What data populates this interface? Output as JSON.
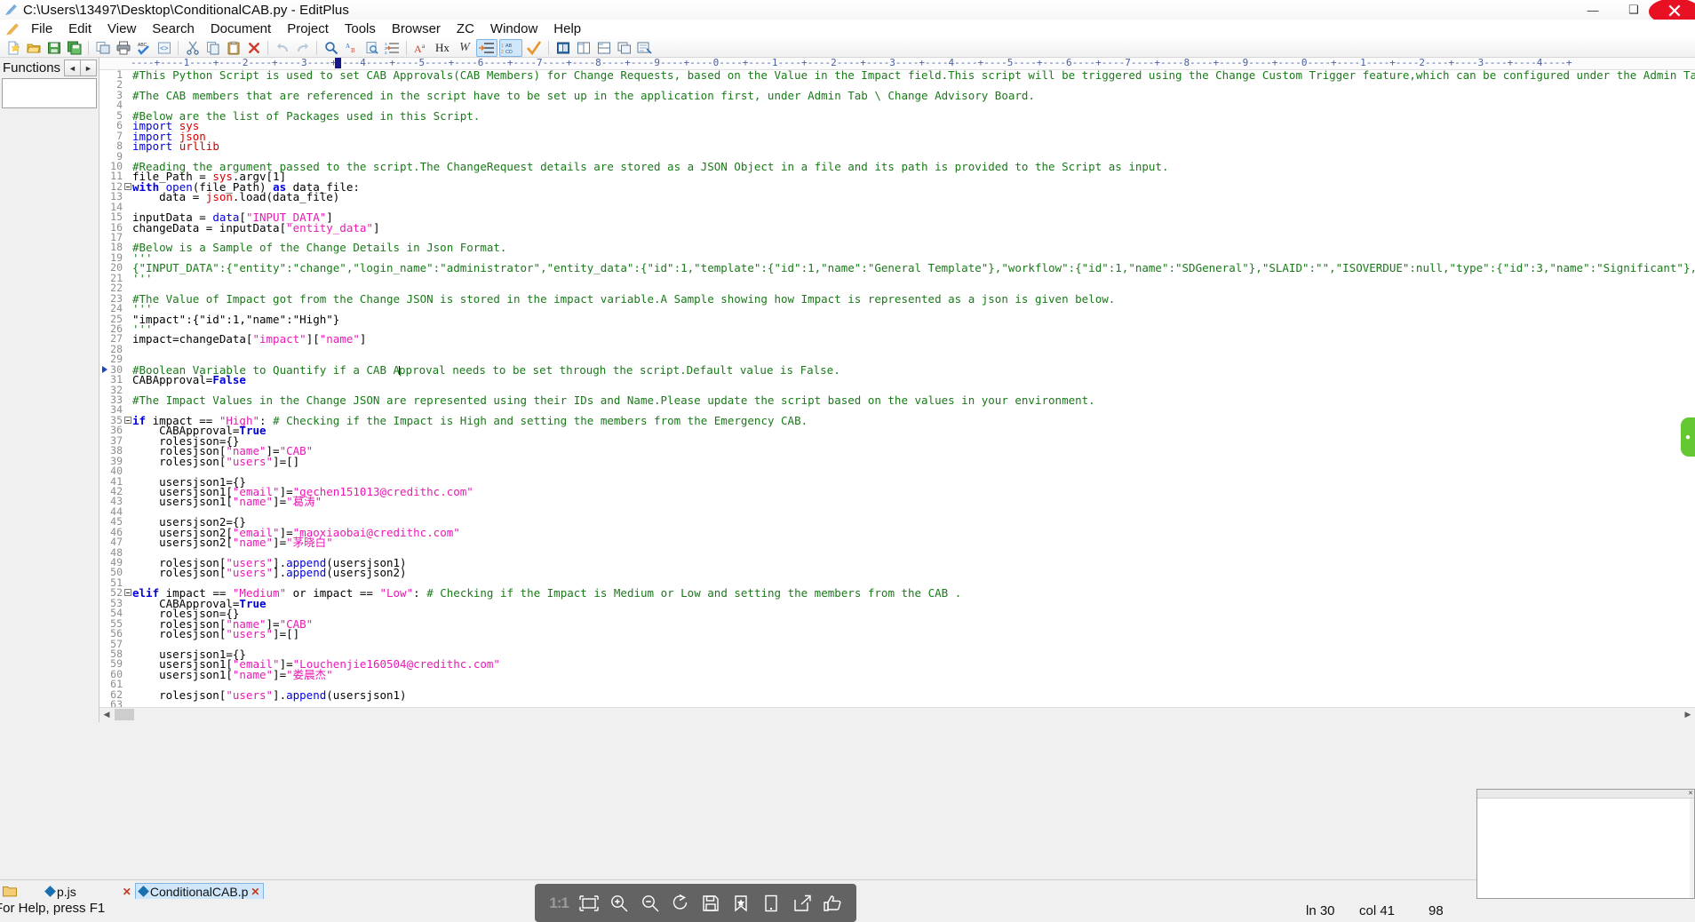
{
  "window": {
    "title": "C:\\Users\\13497\\Desktop\\ConditionalCAB.py - EditPlus",
    "minimize": "—",
    "maximize": "❑",
    "close": "✕"
  },
  "menu": {
    "items": [
      "File",
      "Edit",
      "View",
      "Search",
      "Document",
      "Project",
      "Tools",
      "Browser",
      "ZC",
      "Window",
      "Help"
    ]
  },
  "toolbar": {
    "groups": [
      [
        "new-file",
        "open-file",
        "save-file",
        "save-all"
      ],
      [
        "print-preview",
        "print",
        "spell-check",
        "view-source"
      ],
      [
        "cut",
        "copy",
        "paste",
        "delete"
      ],
      [
        "undo",
        "redo"
      ],
      [
        "find",
        "find-replace",
        "find-in-files",
        "goto-line"
      ],
      [
        "font-color",
        "hex-view",
        "word-wrap",
        "indent",
        "sort",
        "check-syntax"
      ],
      [
        "browser-preview",
        "user-tool"
      ]
    ],
    "labels": {
      "hex": "Hx",
      "word": "W",
      "abcd_top": "1 AB",
      "abcd_bottom": "2 CD"
    }
  },
  "functions_pane": {
    "title": "Functions",
    "prev_label": "◄",
    "next_label": "►"
  },
  "ruler": {
    "text": "----+----1----+----2----+----3----+----4----+----5----+----6----+----7----+----8----+----9----+----0----+----1----+----2----+----3----+----4----+----5----+----6----+----7----+----8----+----9----+----0----+----1----+----2----+----3----+----4----+",
    "caret_column_marker": "4"
  },
  "editor": {
    "lines": [
      {
        "n": 1,
        "mark": "",
        "tokens": [
          {
            "t": "#This Python Script is used to set CAB Approvals(CAB Members) for Change Requests, based on the Value in the Impact field.This script will be triggered using the Change Custom Trigger feature,which can be configured under the Admin Tab \\ Change",
            "c": "com"
          }
        ]
      },
      {
        "n": 2,
        "mark": "",
        "tokens": []
      },
      {
        "n": 3,
        "mark": "",
        "tokens": [
          {
            "t": "#The CAB members that are referenced in the script have to be set up in the application first, under Admin Tab \\ Change Advisory Board.",
            "c": "com"
          }
        ]
      },
      {
        "n": 4,
        "mark": "",
        "tokens": []
      },
      {
        "n": 5,
        "mark": "",
        "tokens": [
          {
            "t": "#Below are the list of Packages used in this Script.",
            "c": "com"
          }
        ]
      },
      {
        "n": 6,
        "mark": "",
        "tokens": [
          {
            "t": "import ",
            "c": "kw2"
          },
          {
            "t": "sys",
            "c": "mod"
          }
        ]
      },
      {
        "n": 7,
        "mark": "",
        "tokens": [
          {
            "t": "import ",
            "c": "kw2"
          },
          {
            "t": "json",
            "c": "mod"
          }
        ]
      },
      {
        "n": 8,
        "mark": "",
        "tokens": [
          {
            "t": "import ",
            "c": "kw2"
          },
          {
            "t": "urllib",
            "c": "mod"
          }
        ]
      },
      {
        "n": 9,
        "mark": "",
        "tokens": []
      },
      {
        "n": 10,
        "mark": "",
        "tokens": [
          {
            "t": "#Reading the argument passed to the script.The ChangeRequest details are stored as a JSON Object in a file and its path is provided to the Script as input.",
            "c": "com"
          }
        ]
      },
      {
        "n": 11,
        "mark": "",
        "tokens": [
          {
            "t": "file_Path = ",
            "c": ""
          },
          {
            "t": "sys",
            "c": "mod"
          },
          {
            "t": ".argv[",
            "c": ""
          },
          {
            "t": "1",
            "c": ""
          },
          {
            "t": "]",
            "c": ""
          }
        ]
      },
      {
        "n": 12,
        "mark": "fold",
        "tokens": [
          {
            "t": "with ",
            "c": "kw"
          },
          {
            "t": "open",
            "c": "kw2"
          },
          {
            "t": "(file_Path) ",
            "c": ""
          },
          {
            "t": "as",
            "c": "kw"
          },
          {
            "t": " data_file:",
            "c": ""
          }
        ]
      },
      {
        "n": 13,
        "mark": "",
        "tokens": [
          {
            "t": "    data = ",
            "c": ""
          },
          {
            "t": "json",
            "c": "mod"
          },
          {
            "t": ".load(data_file)",
            "c": ""
          }
        ]
      },
      {
        "n": 14,
        "mark": "",
        "tokens": []
      },
      {
        "n": 15,
        "mark": "",
        "tokens": [
          {
            "t": "inputData = ",
            "c": ""
          },
          {
            "t": "data",
            "c": "kw2"
          },
          {
            "t": "[",
            "c": ""
          },
          {
            "t": "\"INPUT_DATA\"",
            "c": "str"
          },
          {
            "t": "]",
            "c": ""
          }
        ]
      },
      {
        "n": 16,
        "mark": "",
        "tokens": [
          {
            "t": "changeData = inputData[",
            "c": ""
          },
          {
            "t": "\"entity_data\"",
            "c": "str"
          },
          {
            "t": "]",
            "c": ""
          }
        ]
      },
      {
        "n": 17,
        "mark": "",
        "tokens": []
      },
      {
        "n": 18,
        "mark": "",
        "tokens": [
          {
            "t": "#Below is a Sample of the Change Details in Json Format.",
            "c": "com"
          }
        ]
      },
      {
        "n": 19,
        "mark": "",
        "tokens": [
          {
            "t": "'''",
            "c": "com"
          }
        ]
      },
      {
        "n": 20,
        "mark": "",
        "tokens": [
          {
            "t": "{\"INPUT_DATA\":{\"entity\":\"change\",\"login_name\":\"administrator\",\"entity_data\":{\"id\":1,\"template\":{\"id\":1,\"name\":\"General Template\"},\"workflow\":{\"id\":1,\"name\":\"SDGeneral\"},\"SLAID\":\"\",\"ISOVERDUE\":null,\"type\":{\"id\":3,\"name\":\"Significant\"},\"group\":nul",
            "c": "com"
          }
        ]
      },
      {
        "n": 21,
        "mark": "",
        "tokens": [
          {
            "t": "'''",
            "c": "com"
          }
        ]
      },
      {
        "n": 22,
        "mark": "",
        "tokens": []
      },
      {
        "n": 23,
        "mark": "",
        "tokens": [
          {
            "t": "#The Value of Impact got from the Change JSON is stored in the impact variable.A Sample showing how Impact is represented as a json is given below.",
            "c": "com"
          }
        ]
      },
      {
        "n": 24,
        "mark": "",
        "tokens": [
          {
            "t": "'''",
            "c": "com"
          }
        ]
      },
      {
        "n": 25,
        "mark": "",
        "tokens": [
          {
            "t": "\"impact\":{\"id\":1,\"name\":\"High\"}",
            "c": ""
          }
        ]
      },
      {
        "n": 26,
        "mark": "",
        "tokens": [
          {
            "t": "'''",
            "c": "com"
          }
        ]
      },
      {
        "n": 27,
        "mark": "",
        "tokens": [
          {
            "t": "impact=changeData[",
            "c": ""
          },
          {
            "t": "\"impact\"",
            "c": "str"
          },
          {
            "t": "][",
            "c": ""
          },
          {
            "t": "\"name\"",
            "c": "str"
          },
          {
            "t": "]",
            "c": ""
          }
        ]
      },
      {
        "n": 28,
        "mark": "",
        "tokens": []
      },
      {
        "n": 29,
        "mark": "",
        "tokens": []
      },
      {
        "n": 30,
        "mark": "arrow",
        "tokens": [
          {
            "t": "#Boolean Variable to Quantify if a CAB A",
            "c": "com"
          },
          {
            "t": "|CARET|",
            "c": "caret"
          },
          {
            "t": "pproval needs to be set through the script.Default value is False.",
            "c": "com"
          }
        ]
      },
      {
        "n": 31,
        "mark": "",
        "tokens": [
          {
            "t": "CABApproval=",
            "c": ""
          },
          {
            "t": "False",
            "c": "kw"
          }
        ]
      },
      {
        "n": 32,
        "mark": "",
        "tokens": []
      },
      {
        "n": 33,
        "mark": "",
        "tokens": [
          {
            "t": "#The Impact Values in the Change JSON are represented using their IDs and Name.Please update the script based on the values in your environment.",
            "c": "com"
          }
        ]
      },
      {
        "n": 34,
        "mark": "",
        "tokens": []
      },
      {
        "n": 35,
        "mark": "fold",
        "tokens": [
          {
            "t": "if",
            "c": "kw"
          },
          {
            "t": " impact == ",
            "c": ""
          },
          {
            "t": "\"High\"",
            "c": "str"
          },
          {
            "t": ": ",
            "c": ""
          },
          {
            "t": "# Checking if the Impact is High and setting the members from the Emergency CAB.",
            "c": "com"
          }
        ]
      },
      {
        "n": 36,
        "mark": "",
        "tokens": [
          {
            "t": "    CABApproval=",
            "c": ""
          },
          {
            "t": "True",
            "c": "kw"
          }
        ]
      },
      {
        "n": 37,
        "mark": "",
        "tokens": [
          {
            "t": "    rolesjson={}",
            "c": ""
          }
        ]
      },
      {
        "n": 38,
        "mark": "",
        "tokens": [
          {
            "t": "    rolesjson[",
            "c": ""
          },
          {
            "t": "\"name\"",
            "c": "str"
          },
          {
            "t": "]=",
            "c": ""
          },
          {
            "t": "\"CAB\"",
            "c": "str"
          }
        ]
      },
      {
        "n": 39,
        "mark": "",
        "tokens": [
          {
            "t": "    rolesjson[",
            "c": ""
          },
          {
            "t": "\"users\"",
            "c": "str"
          },
          {
            "t": "]=[]",
            "c": ""
          }
        ]
      },
      {
        "n": 40,
        "mark": "",
        "tokens": []
      },
      {
        "n": 41,
        "mark": "",
        "tokens": [
          {
            "t": "    usersjson1={}",
            "c": ""
          }
        ]
      },
      {
        "n": 42,
        "mark": "",
        "tokens": [
          {
            "t": "    usersjson1[",
            "c": ""
          },
          {
            "t": "\"email\"",
            "c": "str"
          },
          {
            "t": "]=",
            "c": ""
          },
          {
            "t": "\"gechen151013@credithc.com\"",
            "c": "str"
          }
        ]
      },
      {
        "n": 43,
        "mark": "",
        "tokens": [
          {
            "t": "    usersjson1[",
            "c": ""
          },
          {
            "t": "\"name\"",
            "c": "str"
          },
          {
            "t": "]=",
            "c": ""
          },
          {
            "t": "\"葛涛\"",
            "c": "str"
          }
        ]
      },
      {
        "n": 44,
        "mark": "",
        "tokens": []
      },
      {
        "n": 45,
        "mark": "",
        "tokens": [
          {
            "t": "    usersjson2={}",
            "c": ""
          }
        ]
      },
      {
        "n": 46,
        "mark": "",
        "tokens": [
          {
            "t": "    usersjson2[",
            "c": ""
          },
          {
            "t": "\"email\"",
            "c": "str"
          },
          {
            "t": "]=",
            "c": ""
          },
          {
            "t": "\"maoxiaobai@credithc.com\"",
            "c": "str"
          }
        ]
      },
      {
        "n": 47,
        "mark": "",
        "tokens": [
          {
            "t": "    usersjson2[",
            "c": ""
          },
          {
            "t": "\"name\"",
            "c": "str"
          },
          {
            "t": "]=",
            "c": ""
          },
          {
            "t": "\"茅晓白\"",
            "c": "str"
          }
        ]
      },
      {
        "n": 48,
        "mark": "",
        "tokens": []
      },
      {
        "n": 49,
        "mark": "",
        "tokens": [
          {
            "t": "    rolesjson[",
            "c": ""
          },
          {
            "t": "\"users\"",
            "c": "str"
          },
          {
            "t": "].",
            "c": ""
          },
          {
            "t": "append",
            "c": "kw2"
          },
          {
            "t": "(usersjson1)",
            "c": ""
          }
        ]
      },
      {
        "n": 50,
        "mark": "",
        "tokens": [
          {
            "t": "    rolesjson[",
            "c": ""
          },
          {
            "t": "\"users\"",
            "c": "str"
          },
          {
            "t": "].",
            "c": ""
          },
          {
            "t": "append",
            "c": "kw2"
          },
          {
            "t": "(usersjson2)",
            "c": ""
          }
        ]
      },
      {
        "n": 51,
        "mark": "",
        "tokens": []
      },
      {
        "n": 52,
        "mark": "fold",
        "tokens": [
          {
            "t": "elif",
            "c": "kw"
          },
          {
            "t": " impact == ",
            "c": ""
          },
          {
            "t": "\"Medium\"",
            "c": "str"
          },
          {
            "t": " or impact == ",
            "c": ""
          },
          {
            "t": "\"Low\"",
            "c": "str"
          },
          {
            "t": ": ",
            "c": ""
          },
          {
            "t": "# Checking if the Impact is Medium or Low and setting the members from the CAB .",
            "c": "com"
          }
        ]
      },
      {
        "n": 53,
        "mark": "",
        "tokens": [
          {
            "t": "    CABApproval=",
            "c": ""
          },
          {
            "t": "True",
            "c": "kw"
          }
        ]
      },
      {
        "n": 54,
        "mark": "",
        "tokens": [
          {
            "t": "    rolesjson={}",
            "c": ""
          }
        ]
      },
      {
        "n": 55,
        "mark": "",
        "tokens": [
          {
            "t": "    rolesjson[",
            "c": ""
          },
          {
            "t": "\"name\"",
            "c": "str"
          },
          {
            "t": "]=",
            "c": ""
          },
          {
            "t": "\"CAB\"",
            "c": "str"
          }
        ]
      },
      {
        "n": 56,
        "mark": "",
        "tokens": [
          {
            "t": "    rolesjson[",
            "c": ""
          },
          {
            "t": "\"users\"",
            "c": "str"
          },
          {
            "t": "]=[]",
            "c": ""
          }
        ]
      },
      {
        "n": 57,
        "mark": "",
        "tokens": []
      },
      {
        "n": 58,
        "mark": "",
        "tokens": [
          {
            "t": "    usersjson1={}",
            "c": ""
          }
        ]
      },
      {
        "n": 59,
        "mark": "",
        "tokens": [
          {
            "t": "    usersjson1[",
            "c": ""
          },
          {
            "t": "\"email\"",
            "c": "str"
          },
          {
            "t": "]=",
            "c": ""
          },
          {
            "t": "\"Louchenjie160504@credithc.com\"",
            "c": "str"
          }
        ]
      },
      {
        "n": 60,
        "mark": "",
        "tokens": [
          {
            "t": "    usersjson1[",
            "c": ""
          },
          {
            "t": "\"name\"",
            "c": "str"
          },
          {
            "t": "]=",
            "c": ""
          },
          {
            "t": "\"娄晨杰\"",
            "c": "str"
          }
        ]
      },
      {
        "n": 61,
        "mark": "",
        "tokens": []
      },
      {
        "n": 62,
        "mark": "",
        "tokens": [
          {
            "t": "    rolesjson[",
            "c": ""
          },
          {
            "t": "\"users\"",
            "c": "str"
          },
          {
            "t": "].",
            "c": ""
          },
          {
            "t": "append",
            "c": "kw2"
          },
          {
            "t": "(usersjson1)",
            "c": ""
          }
        ]
      },
      {
        "n": 63,
        "mark": "",
        "tokens": []
      },
      {
        "n": 64,
        "mark": "",
        "tokens": []
      }
    ]
  },
  "tabs": {
    "items": [
      {
        "label": "p.js",
        "active": false,
        "close": "✕"
      },
      {
        "label": "ConditionalCAB.p",
        "active": true,
        "close": "✕"
      }
    ]
  },
  "status": {
    "help": "For Help, press F1",
    "line": "ln 30",
    "column": "col 41",
    "count": "98"
  },
  "screenshot_toolbar": {
    "items": [
      {
        "name": "ratio-1-1",
        "label": "1:1"
      },
      {
        "name": "crop-icon",
        "label": ""
      },
      {
        "name": "zoom-in-icon",
        "label": ""
      },
      {
        "name": "zoom-out-icon",
        "label": ""
      },
      {
        "name": "rotate-icon",
        "label": ""
      },
      {
        "name": "save-icon",
        "label": ""
      },
      {
        "name": "favorite-icon",
        "label": ""
      },
      {
        "name": "device-icon",
        "label": ""
      },
      {
        "name": "share-icon",
        "label": ""
      },
      {
        "name": "thumbs-up-icon",
        "label": ""
      }
    ]
  },
  "colors": {
    "comment": "#1a7a1a",
    "keyword": "#0000e0",
    "string": "#e81ab5",
    "module": "#d60000",
    "accent_tab": "#cfe6fb",
    "close_red": "#e81123",
    "ruler": "#4a5fa5"
  }
}
